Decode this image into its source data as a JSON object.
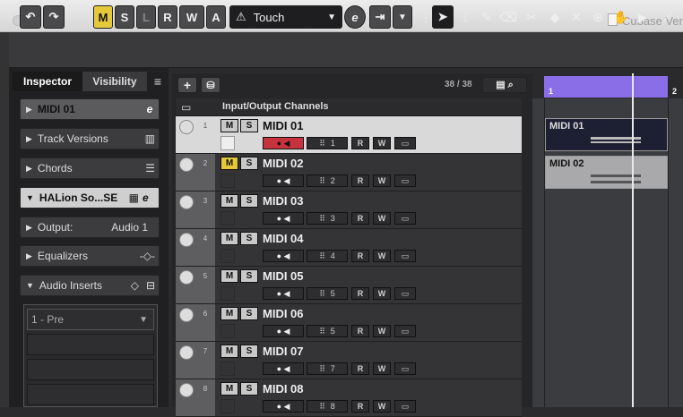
{
  "window": {
    "title": "Cubase Ver"
  },
  "toolbar": {
    "undo": "↶",
    "redo": "↷",
    "mode_buttons": [
      "M",
      "S",
      "L",
      "R",
      "W",
      "A"
    ],
    "automation_mode": "Touch",
    "e_label": "e"
  },
  "inspector": {
    "tabs": [
      "Inspector",
      "Visibility"
    ],
    "menu": "≡",
    "track_name": "MIDI 01",
    "sections": [
      {
        "label": "Track Versions"
      },
      {
        "label": "Chords"
      },
      {
        "label": "HALion So...SE"
      },
      {
        "label": "Output:",
        "value": "Audio 1"
      },
      {
        "label": "Equalizers"
      },
      {
        "label": "Audio Inserts"
      }
    ],
    "insert_slot": "1 - Pre"
  },
  "tracklist": {
    "add": "+",
    "count": "38 / 38",
    "folder_label": "Input/Output Channels",
    "tracks": [
      {
        "num": "1",
        "name": "MIDI 01",
        "channel": "1"
      },
      {
        "num": "2",
        "name": "MIDI 02",
        "channel": "2"
      },
      {
        "num": "3",
        "name": "MIDI 03",
        "channel": "3"
      },
      {
        "num": "4",
        "name": "MIDI 04",
        "channel": "4"
      },
      {
        "num": "5",
        "name": "MIDI 05",
        "channel": "5"
      },
      {
        "num": "6",
        "name": "MIDI 06",
        "channel": "5"
      },
      {
        "num": "7",
        "name": "MIDI 07",
        "channel": "7"
      },
      {
        "num": "8",
        "name": "MIDI 08",
        "channel": "8"
      }
    ],
    "m": "M",
    "s": "S",
    "r": "R",
    "w": "W"
  },
  "project": {
    "ruler": [
      "1",
      "2"
    ],
    "events": [
      "MIDI 01",
      "MIDI 02"
    ]
  },
  "colors": {
    "accent_yellow": "#e6c93a",
    "ruler_purple": "#8a6ee8",
    "record_red": "#c8323c"
  }
}
